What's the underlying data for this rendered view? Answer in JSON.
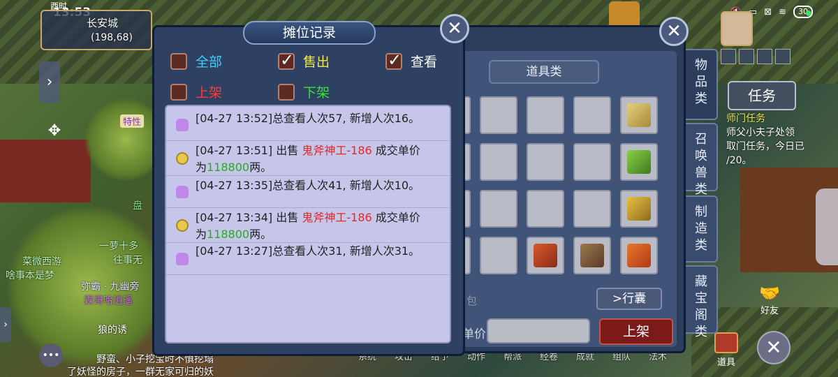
{
  "status_bar": {
    "time": "13:53",
    "battery": "30",
    "icons": [
      "mute-icon",
      "cast-icon",
      "sim-off-icon",
      "wifi-icon",
      "battery-icon"
    ]
  },
  "location": {
    "clock": "酉时",
    "city": "长安城",
    "coords": "(198,68)"
  },
  "left_hud": {
    "special_label": "特性"
  },
  "chat": {
    "lines": [
      {
        "text": "盘",
        "color": "#7ee07e"
      },
      {
        "text": "一萝十多",
        "color": "#b8f0b8"
      },
      {
        "text": "往事无",
        "color": "#b8f0b8"
      },
      {
        "text": "菜微西游",
        "color": "#b8f0b8"
      },
      {
        "text": "啥事本是梦",
        "color": "#b8f0b8"
      },
      {
        "text": "弥霸 · 九幽旁",
        "color": "#e0e0ff"
      },
      {
        "text": "霖哥哈逍遥",
        "color": "#d070e0"
      },
      {
        "text": "狼的诱",
        "color": "#ffffff"
      },
      {
        "text": "野蛮、小子挖宝时不慎挖塌",
        "color": "#ffffff"
      },
      {
        "text": "了妖怪的房子，一群无家可归的妖",
        "color": "#ffffff"
      }
    ]
  },
  "stall_record": {
    "title": "摊位记录",
    "filters": [
      {
        "label": "全部",
        "checked": false,
        "color": "#3ad0ff"
      },
      {
        "label": "售出",
        "checked": true,
        "color": "#f0e84a"
      },
      {
        "label": "查看",
        "checked": true,
        "color": "#ffffff"
      },
      {
        "label": "上架",
        "checked": false,
        "color": "#ff3a3a"
      },
      {
        "label": "下架",
        "checked": false,
        "color": "#3ae03a"
      }
    ],
    "logs": [
      {
        "type": "view",
        "icon": "person-icon",
        "text": "[04-27 13:52]总查看人次57, 新增人次16。"
      },
      {
        "type": "sale",
        "icon": "coin-icon",
        "prefix": "[04-27 13:51] 出售 ",
        "item": "鬼斧神工-186",
        "mid": " 成交单价",
        "line2_prefix": "为",
        "price": "118800",
        "suffix": "两。"
      },
      {
        "type": "view",
        "icon": "person-icon",
        "text": "[04-27 13:35]总查看人次41, 新增人次10。"
      },
      {
        "type": "sale",
        "icon": "coin-icon",
        "prefix": "[04-27 13:34] 出售 ",
        "item": "鬼斧神工-186",
        "mid": " 成交单价",
        "line2_prefix": "为",
        "price": "118800",
        "suffix": "两。"
      },
      {
        "type": "view",
        "icon": "person-icon",
        "text": "[04-27 13:27]总查看人次31, 新增人次31。"
      }
    ]
  },
  "item_panel": {
    "category": "道具类",
    "bag_label": "包",
    "xingnang_button": ">行囊",
    "price_label": "单价",
    "price_value": "",
    "shelve_button": "上架",
    "side_tabs": [
      "物品类",
      "召唤兽类",
      "制造类",
      "藏宝阁类"
    ]
  },
  "right_hud": {
    "task_button": "任务",
    "task_lines": [
      "师门任务",
      "师父小夫子处领",
      "取门任务，今日已",
      "/20。"
    ],
    "task_highlight": "小夫子",
    "friend_label": "好友",
    "bag_label": "道具"
  },
  "bottom_menu": [
    "系统",
    "攻击",
    "给予",
    "动作",
    "帮派",
    "经卷",
    "成就",
    "组队",
    "法术"
  ]
}
